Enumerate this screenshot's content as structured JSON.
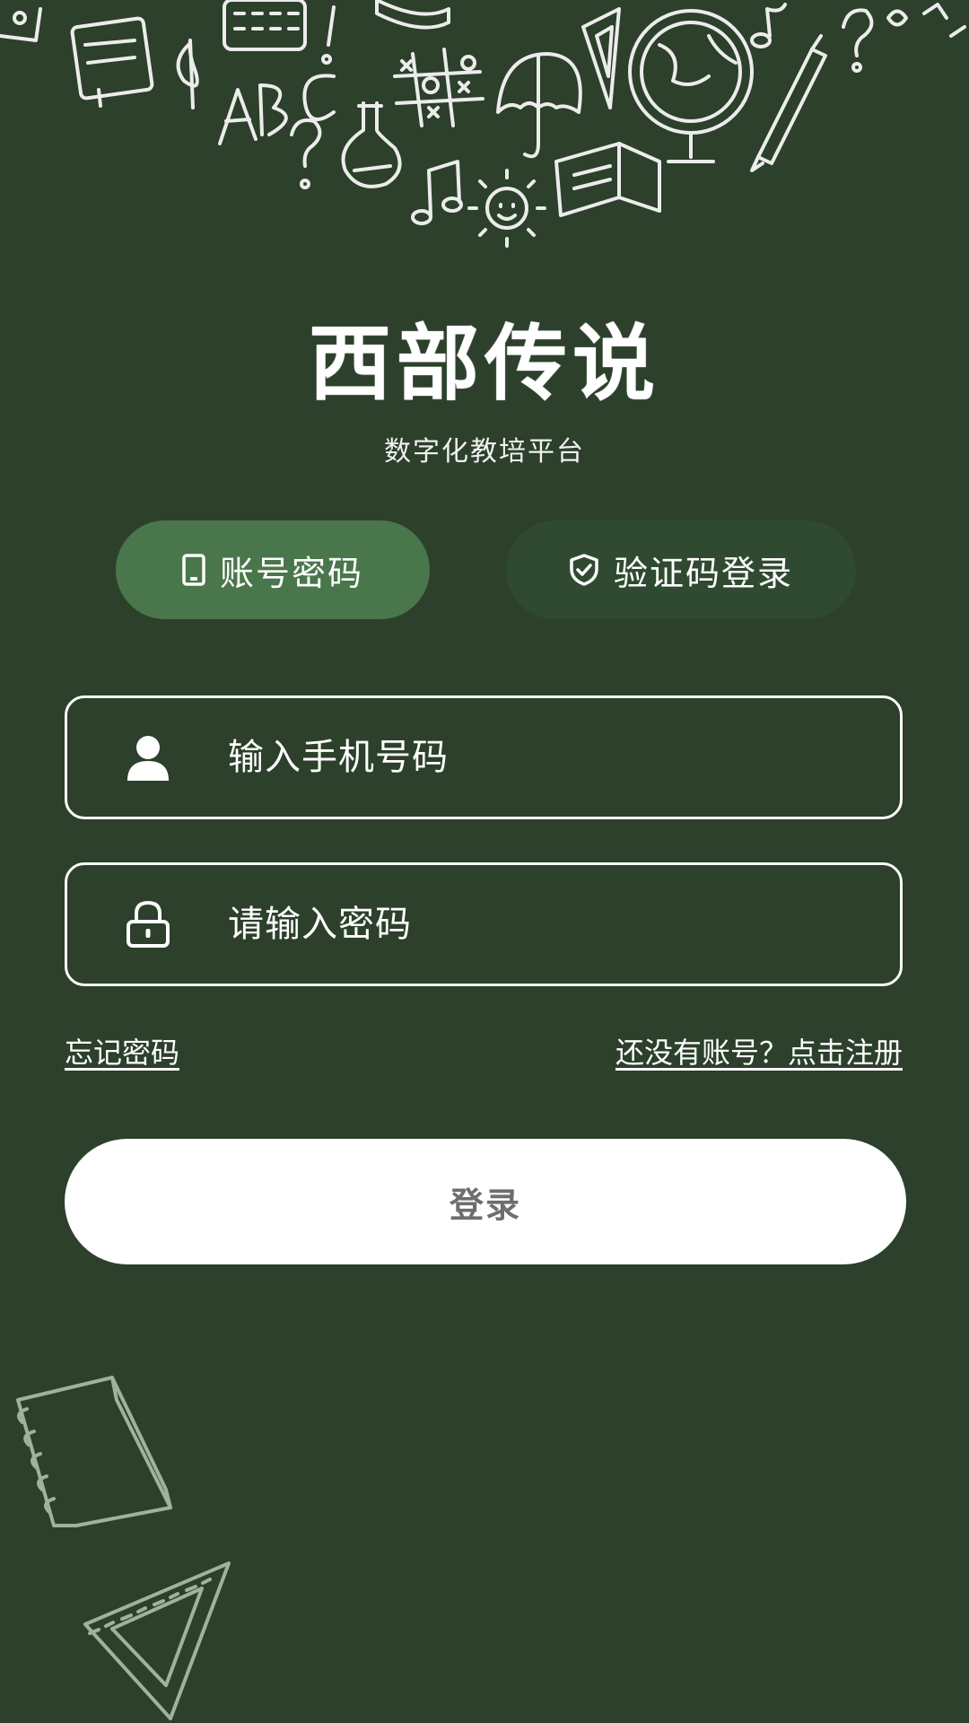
{
  "brand": {
    "title": "西部传说",
    "subtitle": "数字化教培平台"
  },
  "tabs": [
    {
      "label": "账号密码",
      "icon": "phone-icon",
      "active": true
    },
    {
      "label": "验证码登录",
      "icon": "shield-check-icon",
      "active": false
    }
  ],
  "form": {
    "phone": {
      "placeholder": "输入手机号码",
      "value": "",
      "icon": "user-icon"
    },
    "password": {
      "placeholder": "请输入密码",
      "value": "",
      "icon": "lock-icon"
    }
  },
  "links": {
    "forgot": "忘记密码",
    "register": "还没有账号？点击注册"
  },
  "login_button": "登录",
  "colors": {
    "background": "#2c402b",
    "tab_active": "#4a764c",
    "tab_inactive": "#2f4a31",
    "button_text": "#6e6e6e"
  }
}
